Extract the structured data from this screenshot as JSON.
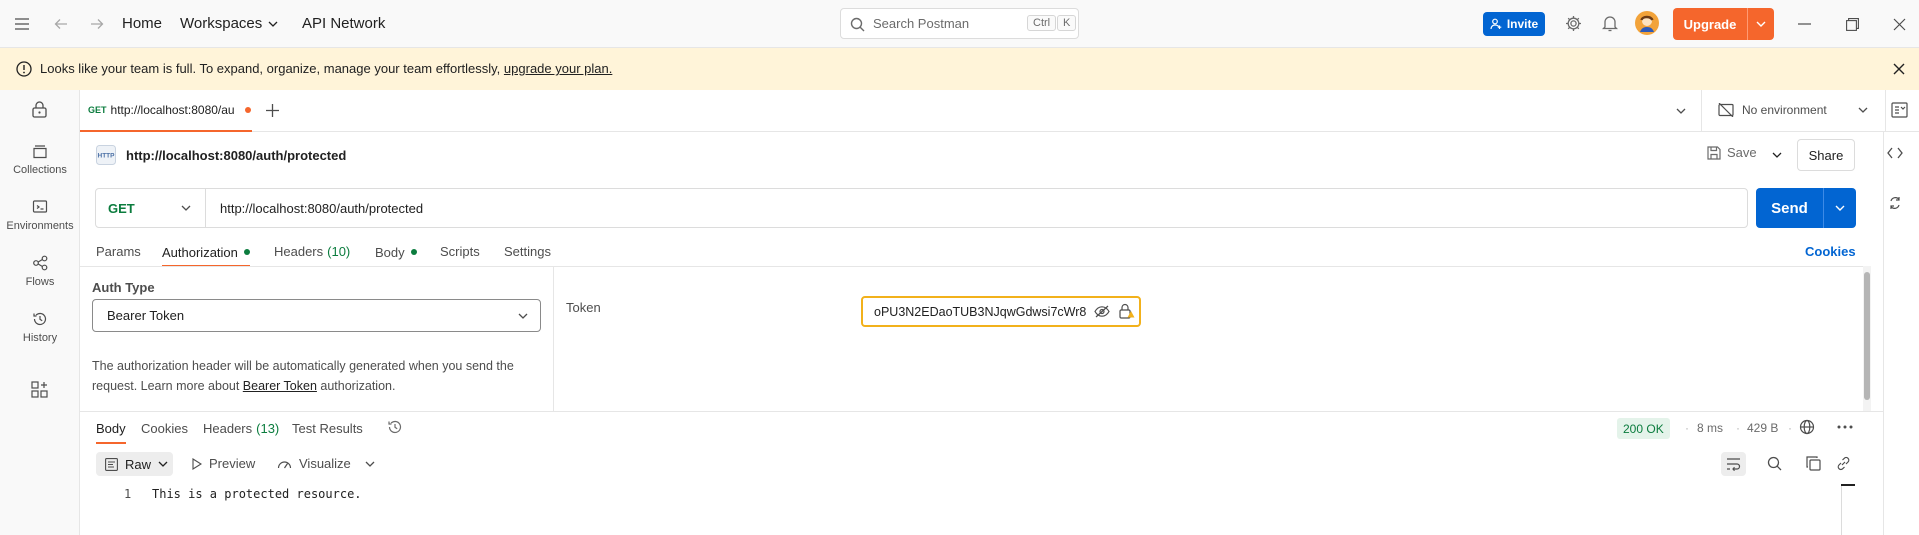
{
  "topbar": {
    "nav_home": "Home",
    "nav_workspaces": "Workspaces",
    "nav_api_network": "API Network",
    "search_placeholder": "Search Postman",
    "search_key1": "Ctrl",
    "search_key2": "K",
    "invite_label": "Invite",
    "upgrade_label": "Upgrade"
  },
  "banner": {
    "message": "Looks like your team is full. To expand, organize, manage your team effortlessly,",
    "link": "upgrade your plan."
  },
  "sidebar": {
    "items": [
      {
        "label": "Collections",
        "icon": "collections-icon"
      },
      {
        "label": "Environments",
        "icon": "environments-icon"
      },
      {
        "label": "Flows",
        "icon": "flows-icon"
      },
      {
        "label": "History",
        "icon": "history-icon"
      }
    ]
  },
  "tabs": {
    "active_method": "GET",
    "active_title": "http://localhost:8080/au",
    "environment": "No environment"
  },
  "request": {
    "name": "http://localhost:8080/auth/protected",
    "method": "GET",
    "url": "http://localhost:8080/auth/protected",
    "save_label": "Save",
    "share_label": "Share",
    "send_label": "Send",
    "subtabs": {
      "params": "Params",
      "authorization": "Authorization",
      "headers": "Headers",
      "headers_count": "(10)",
      "body": "Body",
      "scripts": "Scripts",
      "settings": "Settings",
      "cookies": "Cookies"
    }
  },
  "auth": {
    "type_label": "Auth Type",
    "type_value": "Bearer Token",
    "help_prefix": "The authorization header will be automatically generated when you send the request. Learn more about ",
    "help_link": "Bearer Token",
    "help_suffix": " authorization.",
    "token_label": "Token",
    "token_value": "oPU3N2EDaoTUB3NJqwGdwsi7cWr8"
  },
  "response": {
    "tabs": {
      "body": "Body",
      "cookies": "Cookies",
      "headers": "Headers",
      "headers_count": "(13)",
      "test_results": "Test Results"
    },
    "status": "200 OK",
    "time": "8 ms",
    "size": "429 B",
    "view_raw": "Raw",
    "view_preview": "Preview",
    "view_visualize": "Visualize",
    "lines": [
      {
        "number": "1",
        "text": "This is a protected resource."
      }
    ]
  },
  "colors": {
    "accent_orange": "#f5662c",
    "accent_blue": "#0265d2",
    "status_green": "#0b7c3e",
    "banner_bg": "#fff4d9"
  }
}
